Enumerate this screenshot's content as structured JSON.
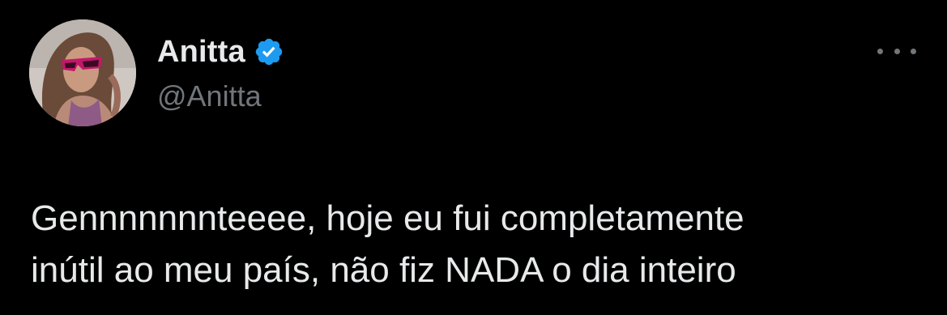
{
  "tweet": {
    "author": {
      "display_name": "Anitta",
      "handle": "@Anitta",
      "verified": true,
      "verified_color": "#1d9bf0"
    },
    "more_icon": "more-horizontal-icon",
    "text_line_1": "Gennnnnnnteeee, hoje eu fui completamente",
    "text_line_2": "inútil ao meu país, não fiz NADA o dia inteiro"
  },
  "colors": {
    "background": "#000000",
    "primary_text": "#e7e9ea",
    "secondary_text": "#71767b"
  }
}
